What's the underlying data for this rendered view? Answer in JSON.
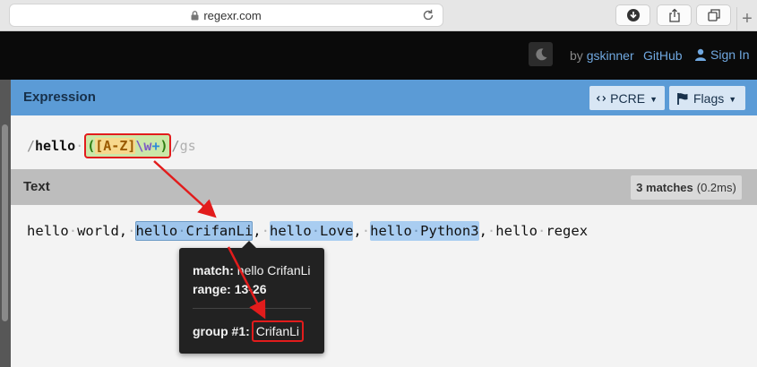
{
  "browser": {
    "url": "regexr.com"
  },
  "header": {
    "by_prefix": "by",
    "author": "gskinner",
    "github": "GitHub",
    "sign_in": "Sign In"
  },
  "expression": {
    "title": "Expression",
    "engine": "PCRE",
    "flags_label": "Flags",
    "pattern": {
      "open": "/",
      "literal": "hello",
      "space": "·",
      "open_paren": "(",
      "charset": "[A-Z]",
      "escape": "\\w",
      "quantifier": "+",
      "close_paren": ")",
      "close": "/",
      "flags": "gs"
    }
  },
  "text_panel": {
    "title": "Text",
    "match_count": "3 matches",
    "match_time": "(0.2ms)",
    "segments": [
      {
        "t": "hello·world,·",
        "match": false
      },
      {
        "t": "hello·CrifanLi",
        "match": true,
        "hover": true
      },
      {
        "t": ",·",
        "match": false
      },
      {
        "t": "hello·Love",
        "match": true
      },
      {
        "t": ",·",
        "match": false
      },
      {
        "t": "hello·Python3",
        "match": true
      },
      {
        "t": ",·hello·regex",
        "match": false
      }
    ]
  },
  "tooltip": {
    "match_label": "match:",
    "match_value": "hello CrifanLi",
    "range_label": "range:",
    "range_value": "13-26",
    "group_label": "group #1:",
    "group_value": "CrifanLi"
  },
  "colors": {
    "expression_bar": "#5b9bd6",
    "match_highlight": "#a9cdf1",
    "annotation_red": "#e21c1c"
  }
}
